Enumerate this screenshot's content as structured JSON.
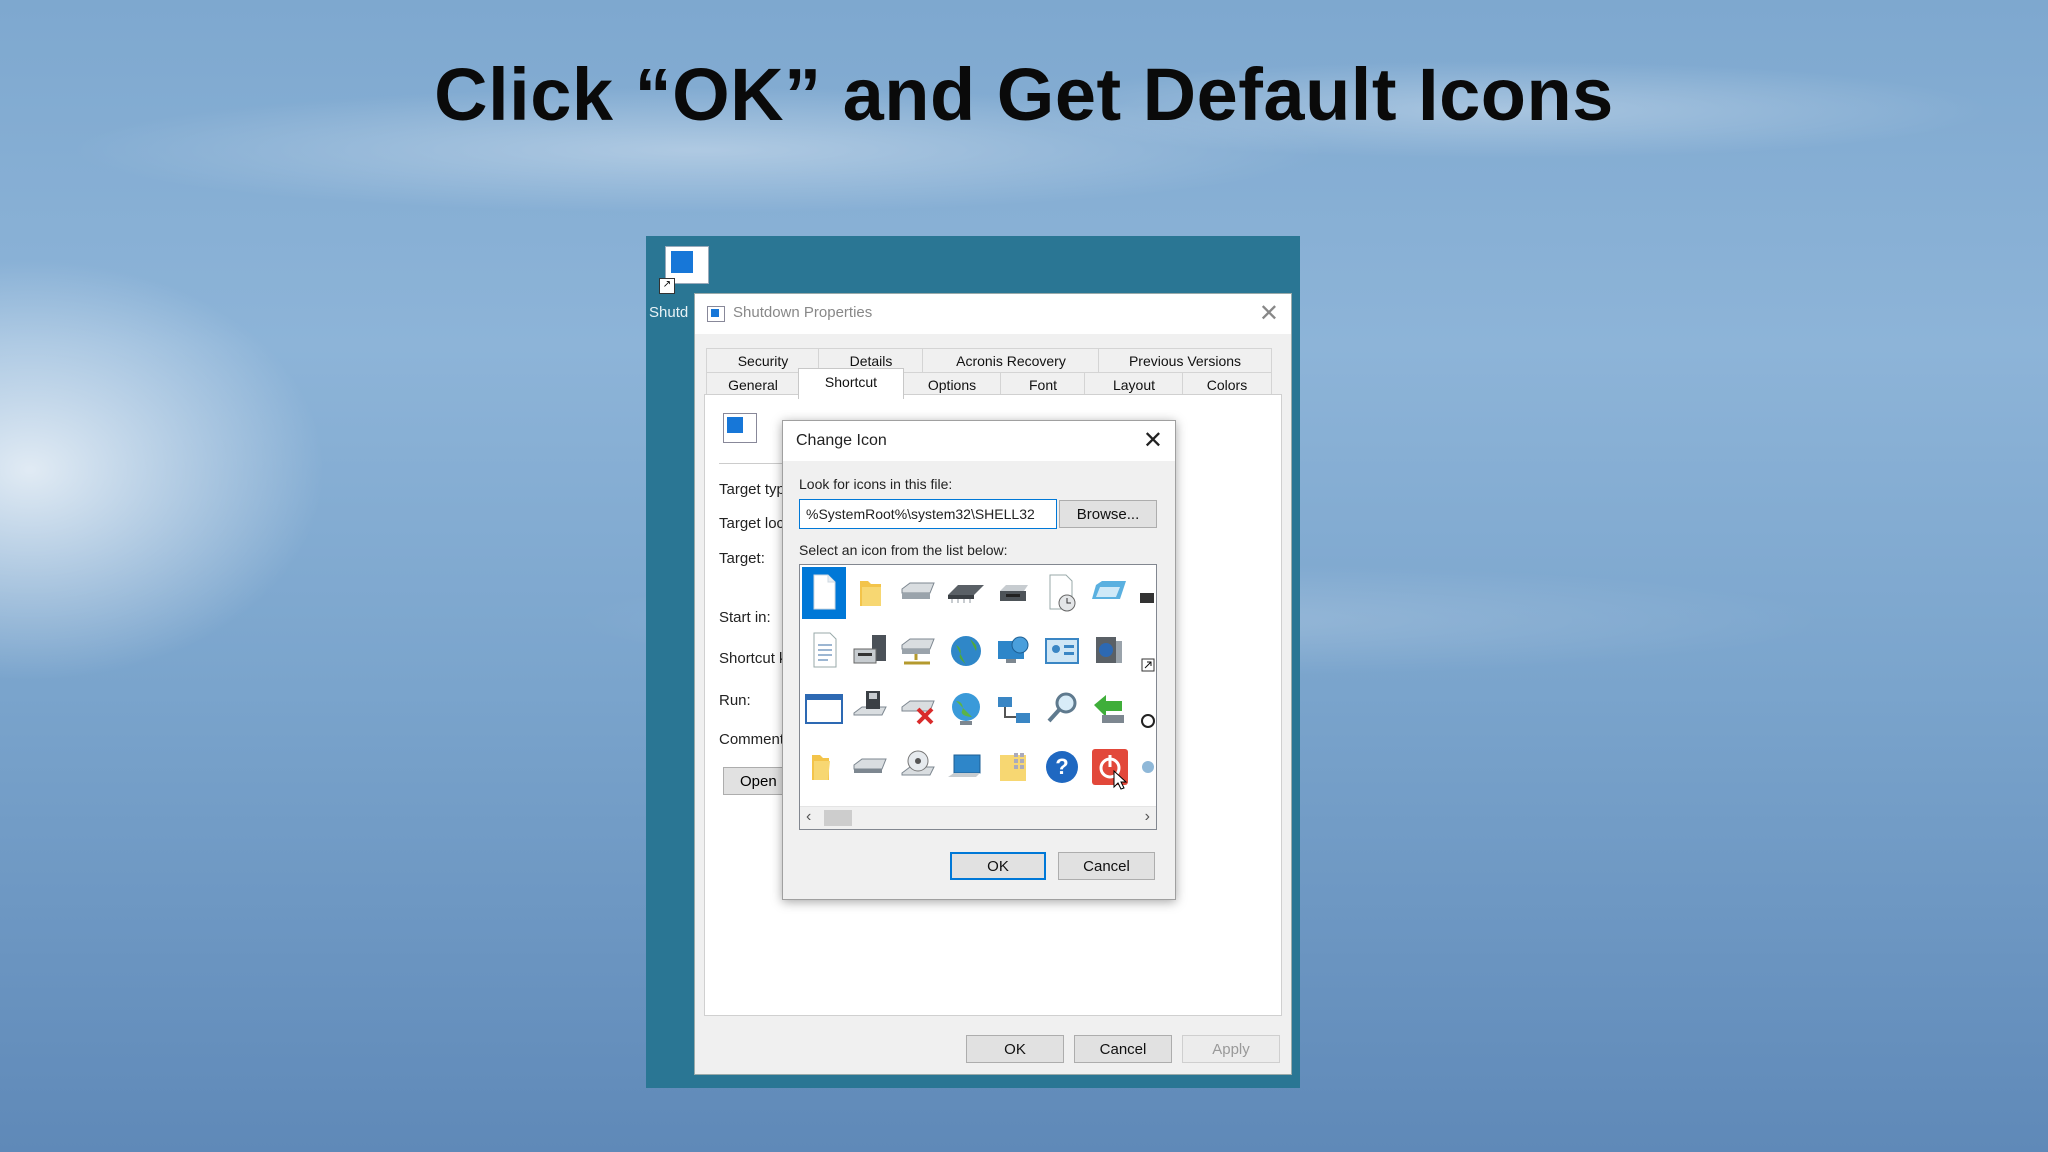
{
  "slide": {
    "title": "Click “OK” and Get Default Icons"
  },
  "desktop": {
    "shortcut_label": "Shutd"
  },
  "props_window": {
    "title": "Shutdown Properties",
    "tabs_back": [
      "Security",
      "Details",
      "Acronis Recovery",
      "Previous Versions"
    ],
    "tabs_front": [
      "General",
      "Shortcut",
      "Options",
      "Font",
      "Layout",
      "Colors"
    ],
    "active_tab": "Shortcut",
    "labels": [
      "Target typ",
      "Target loc",
      "Target:",
      "Start in:",
      "Shortcut k",
      "Run:",
      "Comment:"
    ],
    "open_button": "Open",
    "ok": "OK",
    "cancel": "Cancel",
    "apply": "Apply"
  },
  "change_icon": {
    "title": "Change Icon",
    "look_label": "Look for icons in this file:",
    "file_path": "%SystemRoot%\\system32\\SHELL32",
    "browse": "Browse...",
    "select_label": "Select an icon from the list below:",
    "ok": "OK",
    "cancel": "Cancel",
    "icons": [
      [
        "blank-document-icon",
        "folder-icon",
        "drive-icon",
        "memory-chip-icon",
        "printer-icon",
        "document-clock-icon",
        "window-app-icon",
        "partial-icon"
      ],
      [
        "text-document-icon",
        "server-icon",
        "network-drive-icon",
        "globe-icon",
        "monitor-globe-icon",
        "control-panel-icon",
        "speaker-icon",
        "shortcut-arrow-icon"
      ],
      [
        "application-window-icon",
        "floppy-drive-icon",
        "disconnected-drive-icon",
        "internet-globe-icon",
        "network-icon",
        "search-icon",
        "move-arrow-icon",
        "partial-icon"
      ],
      [
        "open-folder-icon",
        "cd-drive-icon",
        "cd-rom-icon",
        "desktop-computer-icon",
        "folder-grid-icon",
        "help-icon",
        "power-icon",
        "partial-icon"
      ]
    ],
    "selected_icon": "blank-document-icon"
  },
  "colors": {
    "accent": "#0078d7",
    "desktop": "#2a7694"
  }
}
